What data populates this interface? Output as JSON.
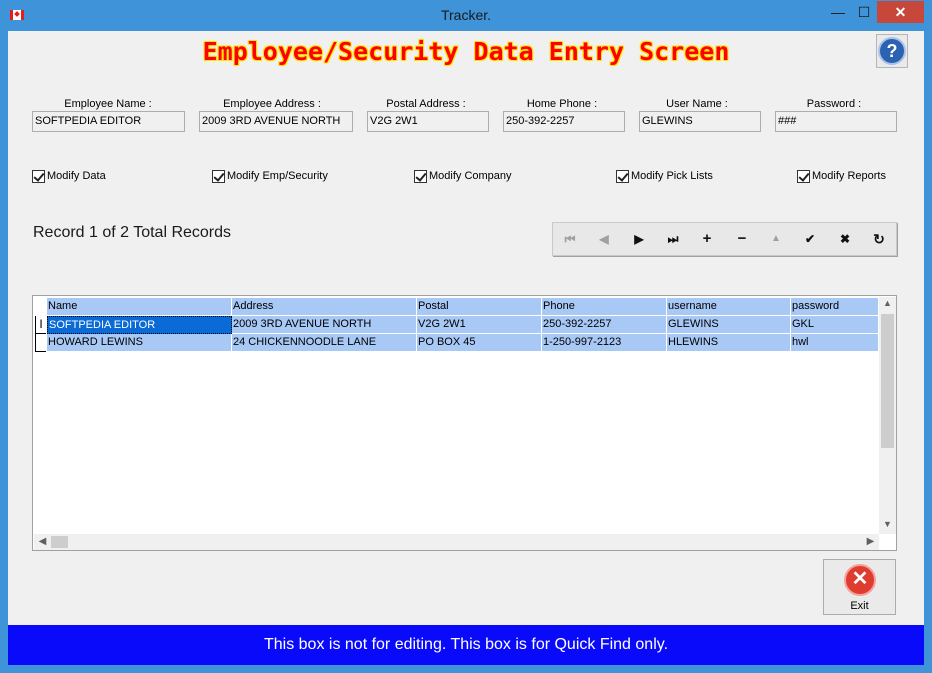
{
  "window": {
    "title": "Tracker."
  },
  "heading": "Employee/Security Data Entry Screen",
  "help": {
    "label": "?"
  },
  "fields": [
    {
      "label": "Employee Name :",
      "value": "SOFTPEDIA EDITOR"
    },
    {
      "label": "Employee Address :",
      "value": "2009 3RD AVENUE NORTH"
    },
    {
      "label": "Postal Address :",
      "value": "V2G 2W1"
    },
    {
      "label": "Home Phone :",
      "value": "250-392-2257"
    },
    {
      "label": "User Name :",
      "value": "GLEWINS"
    },
    {
      "label": "Password :",
      "value": "###"
    }
  ],
  "permissions": [
    {
      "label": "Modify Data",
      "checked": true
    },
    {
      "label": "Modify Emp/Security",
      "checked": true
    },
    {
      "label": "Modify Company",
      "checked": true
    },
    {
      "label": "Modify Pick Lists",
      "checked": true
    },
    {
      "label": "Modify Reports",
      "checked": true
    }
  ],
  "record_status": "Record 1 of 2 Total Records",
  "navigator": {
    "first": "⏮",
    "prior": "◀",
    "next": "▶",
    "last": "⏭",
    "insert": "+",
    "delete": "−",
    "edit": "▲",
    "post": "✔",
    "cancel": "✖",
    "refresh": "↻"
  },
  "grid": {
    "columns": [
      "Name",
      "Address",
      "Postal",
      "Phone",
      "username",
      "password"
    ],
    "rows": [
      [
        "SOFTPEDIA EDITOR",
        "2009 3RD AVENUE NORTH",
        "V2G 2W1",
        "250-392-2257",
        "GLEWINS",
        "GKL"
      ],
      [
        "HOWARD LEWINS",
        "24 CHICKENNOODLE LANE",
        "PO BOX 45",
        "1-250-997-2123",
        "HLEWINS",
        "hwl"
      ]
    ],
    "row_indicator": "I"
  },
  "exit": {
    "label": "Exit",
    "icon": "✕"
  },
  "quickfind": "This box is not for editing.  This box is for Quick Find only."
}
